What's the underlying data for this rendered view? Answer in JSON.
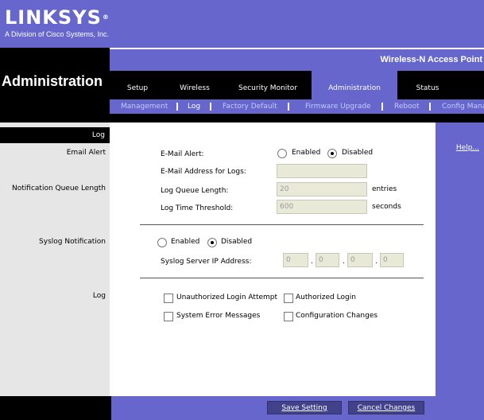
{
  "brand": {
    "logo": "LINKSYS",
    "reg": "®",
    "sub": "A Division of Cisco Systems, Inc."
  },
  "product": "Wireless-N Access Point",
  "section_title": "Administration",
  "tabs": [
    {
      "label": "Setup",
      "active": false
    },
    {
      "label": "Wireless",
      "active": false
    },
    {
      "label": "Security Monitor",
      "active": false
    },
    {
      "label": "Administration",
      "active": true
    },
    {
      "label": "Status",
      "active": false
    }
  ],
  "subnav": [
    {
      "label": "Management",
      "active": false
    },
    {
      "label": "Log",
      "active": true
    },
    {
      "label": "Factory Default",
      "active": false
    },
    {
      "label": "Firmware Upgrade",
      "active": false
    },
    {
      "label": "Reboot",
      "active": false
    },
    {
      "label": "Config Mana",
      "active": false
    }
  ],
  "left": {
    "header": "Log",
    "email_alert": "Email Alert",
    "notification_queue": "Notification Queue Length",
    "syslog_notification": "Syslog Notification",
    "log": "Log"
  },
  "help": "Help...",
  "email": {
    "alert_label": "E-Mail Alert:",
    "enabled": "Enabled",
    "disabled": "Disabled",
    "selected": "disabled",
    "address_label": "E-Mail Address for Logs:",
    "address_value": "",
    "queue_label": "Log Queue Length:",
    "queue_value": "20",
    "queue_unit": "entries",
    "threshold_label": "Log Time Threshold:",
    "threshold_value": "600",
    "threshold_unit": "seconds"
  },
  "syslog": {
    "enabled": "Enabled",
    "disabled": "Disabled",
    "selected": "disabled",
    "ip_label": "Syslog Server IP Address:",
    "ip": [
      "0",
      "0",
      "0",
      "0"
    ]
  },
  "log_options": {
    "unauthorized": "Unauthorized Login Attempt",
    "authorized": "Authorized Login",
    "system_errors": "System Error Messages",
    "config_changes": "Configuration Changes"
  },
  "buttons": {
    "save": "Save Setting",
    "cancel": "Cancel Changes"
  }
}
